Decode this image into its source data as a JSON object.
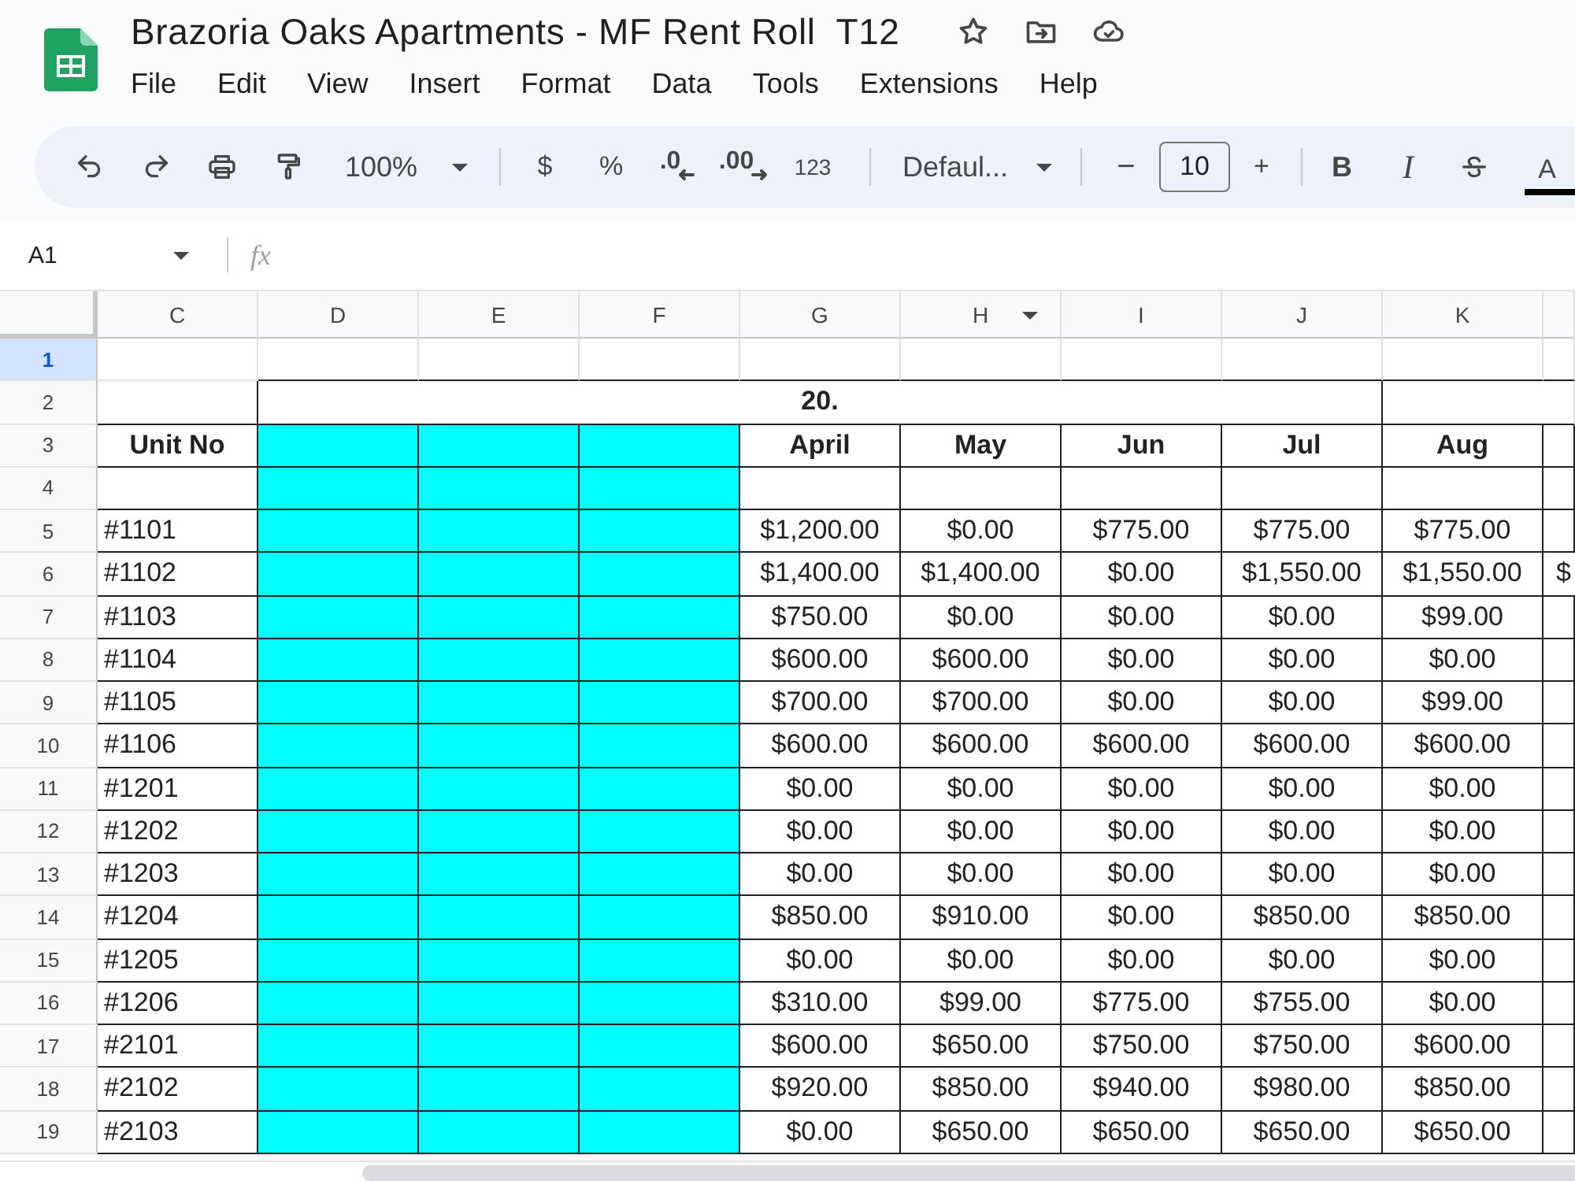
{
  "app": {
    "title": "Brazoria Oaks Apartments - MF Rent Roll  T12",
    "menu": [
      "File",
      "Edit",
      "View",
      "Insert",
      "Format",
      "Data",
      "Tools",
      "Extensions",
      "Help"
    ]
  },
  "toolbar": {
    "zoom": "100%",
    "number_formats": [
      {
        "kind": "currency",
        "label": "$"
      },
      {
        "kind": "percent",
        "label": "%"
      },
      {
        "kind": "decrease",
        "label": ".0"
      },
      {
        "kind": "increase",
        "label": ".00"
      },
      {
        "kind": "format",
        "label": "123"
      }
    ],
    "font": "Defaul...",
    "font_size": {
      "minus": "−",
      "value": "10",
      "plus": "+"
    },
    "styles": [
      {
        "kind": "bold",
        "label": "B"
      },
      {
        "kind": "italic",
        "label": "I"
      },
      {
        "kind": "strike"
      },
      {
        "kind": "color",
        "label": "A"
      }
    ]
  },
  "formula_bar": {
    "name_box": "A1",
    "function_label": "fx"
  },
  "sheet": {
    "columns": [
      {
        "label": "C",
        "hovered": false
      },
      {
        "label": "D",
        "hovered": false
      },
      {
        "label": "E",
        "hovered": false
      },
      {
        "label": "F",
        "hovered": false
      },
      {
        "label": "G",
        "hovered": false
      },
      {
        "label": "H",
        "hovered": true
      },
      {
        "label": "I",
        "hovered": false
      },
      {
        "label": "J",
        "hovered": false
      },
      {
        "label": "K",
        "hovered": false
      }
    ],
    "rows": [
      {
        "number": "1",
        "selected": true,
        "kind": "empty"
      },
      {
        "number": "2",
        "selected": false,
        "kind": "title",
        "title": "20."
      },
      {
        "number": "3",
        "selected": false,
        "kind": "header",
        "unit": "Unit No",
        "months": [
          "April",
          "May",
          "Jun",
          "Jul",
          "Aug"
        ]
      },
      {
        "number": "4",
        "selected": false,
        "kind": "spacer"
      },
      {
        "number": "5",
        "selected": false,
        "kind": "data",
        "unit": "#1101",
        "values": [
          "$1,200.00",
          "$0.00",
          "$775.00",
          "$775.00",
          "$775.00"
        ]
      },
      {
        "number": "6",
        "selected": false,
        "kind": "data",
        "unit": "#1102",
        "values": [
          "$1,400.00",
          "$1,400.00",
          "$0.00",
          "$1,550.00",
          "$1,550.00",
          "$"
        ]
      },
      {
        "number": "7",
        "selected": false,
        "kind": "data",
        "unit": "#1103",
        "values": [
          "$750.00",
          "$0.00",
          "$0.00",
          "$0.00",
          "$99.00"
        ]
      },
      {
        "number": "8",
        "selected": false,
        "kind": "data",
        "unit": "#1104",
        "values": [
          "$600.00",
          "$600.00",
          "$0.00",
          "$0.00",
          "$0.00"
        ]
      },
      {
        "number": "9",
        "selected": false,
        "kind": "data",
        "unit": "#1105",
        "values": [
          "$700.00",
          "$700.00",
          "$0.00",
          "$0.00",
          "$99.00"
        ]
      },
      {
        "number": "10",
        "selected": false,
        "kind": "data",
        "unit": "#1106",
        "values": [
          "$600.00",
          "$600.00",
          "$600.00",
          "$600.00",
          "$600.00"
        ]
      },
      {
        "number": "11",
        "selected": false,
        "kind": "data",
        "unit": "#1201",
        "values": [
          "$0.00",
          "$0.00",
          "$0.00",
          "$0.00",
          "$0.00"
        ]
      },
      {
        "number": "12",
        "selected": false,
        "kind": "data",
        "unit": "#1202",
        "values": [
          "$0.00",
          "$0.00",
          "$0.00",
          "$0.00",
          "$0.00"
        ]
      },
      {
        "number": "13",
        "selected": false,
        "kind": "data",
        "unit": "#1203",
        "values": [
          "$0.00",
          "$0.00",
          "$0.00",
          "$0.00",
          "$0.00"
        ]
      },
      {
        "number": "14",
        "selected": false,
        "kind": "data",
        "unit": "#1204",
        "values": [
          "$850.00",
          "$910.00",
          "$0.00",
          "$850.00",
          "$850.00"
        ]
      },
      {
        "number": "15",
        "selected": false,
        "kind": "data",
        "unit": "#1205",
        "values": [
          "$0.00",
          "$0.00",
          "$0.00",
          "$0.00",
          "$0.00"
        ]
      },
      {
        "number": "16",
        "selected": false,
        "kind": "data",
        "unit": "#1206",
        "values": [
          "$310.00",
          "$99.00",
          "$775.00",
          "$755.00",
          "$0.00"
        ]
      },
      {
        "number": "17",
        "selected": false,
        "kind": "data",
        "unit": "#2101",
        "values": [
          "$600.00",
          "$650.00",
          "$750.00",
          "$750.00",
          "$600.00"
        ]
      },
      {
        "number": "18",
        "selected": false,
        "kind": "data",
        "unit": "#2102",
        "values": [
          "$920.00",
          "$850.00",
          "$940.00",
          "$980.00",
          "$850.00"
        ]
      },
      {
        "number": "19",
        "selected": false,
        "kind": "data",
        "unit": "#2103",
        "values": [
          "$0.00",
          "$650.00",
          "$650.00",
          "$650.00",
          "$650.00"
        ]
      }
    ]
  }
}
